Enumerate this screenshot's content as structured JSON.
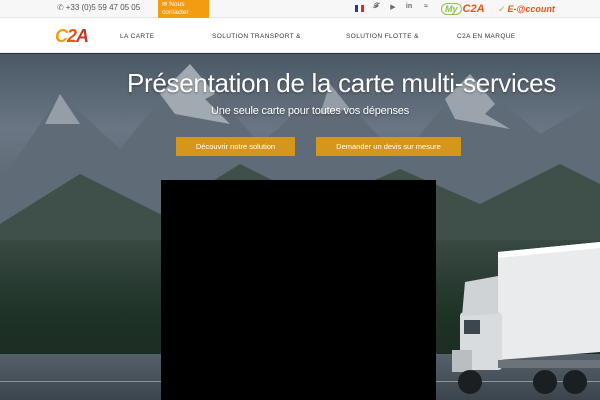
{
  "topbar": {
    "phone": "+33 (0)5 59 47 05 05",
    "phone_icon": "phone-icon",
    "contact_label": "Nous contacter",
    "contact_icon": "envelope-icon",
    "language_flag": "french-flag-icon",
    "social_icons": [
      "twitter-icon",
      "youtube-icon",
      "linkedin-icon",
      "rss-icon"
    ],
    "my_label": "My",
    "my_brand": "C2A",
    "eaccount_label": "E-@ccount"
  },
  "nav": {
    "logo": "C2A",
    "items": [
      {
        "label": "LA CARTE"
      },
      {
        "label": "SOLUTION TRANSPORT &"
      },
      {
        "label": "SOLUTION FLOTTE &"
      },
      {
        "label": "C2A EN MARQUE"
      }
    ]
  },
  "hero": {
    "title": "Présentation de la carte multi-services",
    "subtitle": "Une seule carte pour toutes vos dépenses",
    "button_primary": "Découvrir notre solution",
    "button_secondary": "Demander un devis sur mesure"
  },
  "colors": {
    "accent_orange": "#f39c12",
    "button_gold": "#d4961c",
    "brand_red": "#e8541c",
    "brand_green": "#8cc63f"
  }
}
